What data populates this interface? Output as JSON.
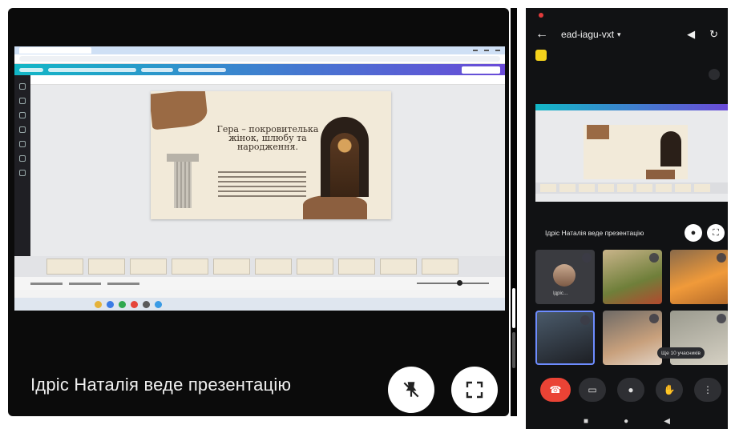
{
  "presentation": {
    "presenter_text": "Ідріс Наталія веде презентацію",
    "slide": {
      "title": "Гера – покровителька жінок, шлюбу та народження."
    },
    "buttons": {
      "unpin_icon": "pin-off-icon",
      "fullscreen_icon": "fullscreen-icon"
    }
  },
  "phone": {
    "header": {
      "meeting_code": "ead-iagu-vxt",
      "chevron": "▾"
    },
    "presenting_label": "Ідріс Наталія веде презентацію",
    "participant_name": "Ідріс…",
    "more_participants": "Ще 10 учасників",
    "controls": {
      "end_call_icon": "end-call-icon",
      "camera_icon": "camera-icon",
      "mic_icon": "microphone-icon",
      "hand_icon": "raise-hand-icon",
      "more_icon": "more-options-icon"
    },
    "colors": {
      "end_call": "#ea4335",
      "active_tile_border": "#6d8cff",
      "badge": "#f4d21c"
    }
  }
}
